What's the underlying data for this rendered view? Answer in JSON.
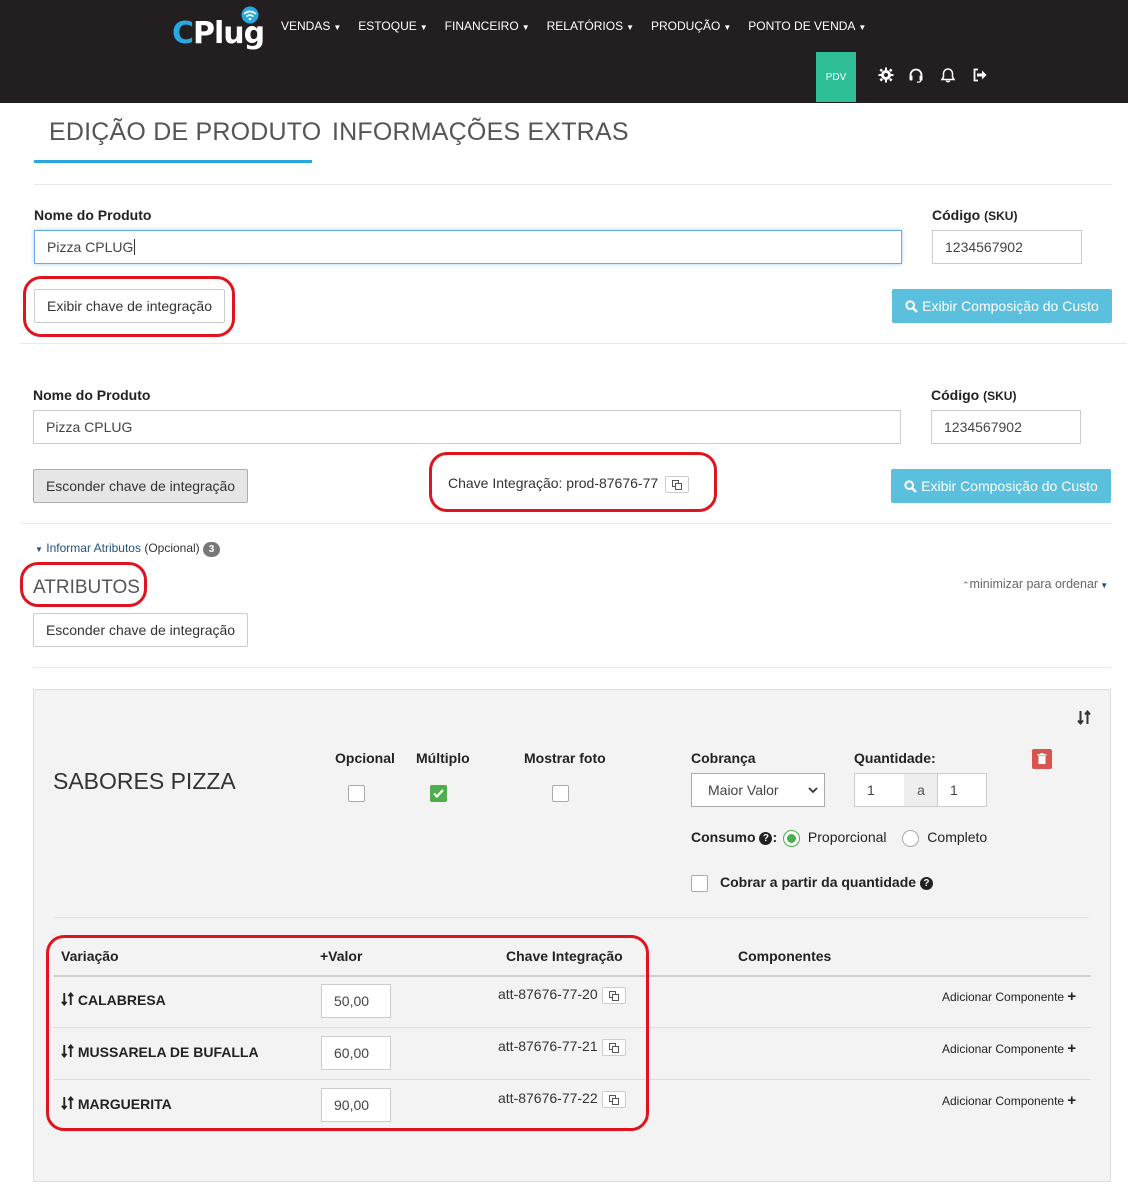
{
  "nav": {
    "menu": [
      "VENDAS",
      "ESTOQUE",
      "FINANCEIRO",
      "RELATÓRIOS",
      "PRODUÇÃO",
      "PONTO DE VENDA"
    ],
    "pdv_label": "PDV",
    "icons": [
      "gear-icon",
      "headset-icon",
      "bell-icon",
      "sign-out-icon"
    ]
  },
  "tabs": [
    "EDIÇÃO DE PRODUTO",
    "INFORMAÇÕES EXTRAS"
  ],
  "form1": {
    "name_label": "Nome do Produto",
    "name_value": "Pizza CPLUG",
    "sku_label": "Código",
    "sku_suffix": "(SKU)",
    "sku_value": "1234567902",
    "show_key_button": "Exibir chave de integração",
    "cost_button": "Exibir Composição do Custo"
  },
  "form2": {
    "name_label": "Nome do Produto",
    "name_value": "Pizza CPLUG",
    "sku_label": "Código",
    "sku_suffix": "(SKU)",
    "sku_value": "1234567902",
    "hide_key_button": "Esconder chave de integração",
    "key_text": "Chave Integração: prod-87676-77",
    "cost_button": "Exibir Composição do Custo"
  },
  "attributes": {
    "toggle_link": "Informar Atributos",
    "optional_text": "(Opcional)",
    "count": "3",
    "title": "ATRIBUTOS",
    "minimize_link": "minimizar para ordenar",
    "hide_key_button": "Esconder chave de integração"
  },
  "group": {
    "title": "SABORES PIZZA",
    "optional_label": "Opcional",
    "multiple_label": "Múltiplo",
    "show_photo_label": "Mostrar foto",
    "optional_checked": false,
    "multiple_checked": true,
    "show_photo_checked": false,
    "billing_label": "Cobrança",
    "billing_value": "Maior Valor",
    "quantity_label": "Quantidade:",
    "qty_min": "1",
    "qty_sep": "a",
    "qty_max": "1",
    "consumption_label": "Consumo",
    "consumption_options": [
      "Proporcional",
      "Completo"
    ],
    "consumption_selected": "Proporcional",
    "charge_from_qty_label": "Cobrar a partir da quantidade",
    "headers": {
      "variation": "Variação",
      "value": "+Valor",
      "key": "Chave Integração",
      "components": "Componentes"
    },
    "rows": [
      {
        "name": "CALABRESA",
        "value": "50,00",
        "key": "att-87676-77-20",
        "add": "Adicionar Componente"
      },
      {
        "name": "MUSSARELA DE BUFALLA",
        "value": "60,00",
        "key": "att-87676-77-21",
        "add": "Adicionar Componente"
      },
      {
        "name": "MARGUERITA",
        "value": "90,00",
        "key": "att-87676-77-22",
        "add": "Adicionar Componente"
      }
    ]
  },
  "colors": {
    "nav_bg": "#231f20",
    "brand_blue": "#29a8e0",
    "pdv_green": "#2ebf97",
    "info_button": "#5bc0de",
    "annotation_red": "#e0141e",
    "check_green": "#4cae4c"
  }
}
